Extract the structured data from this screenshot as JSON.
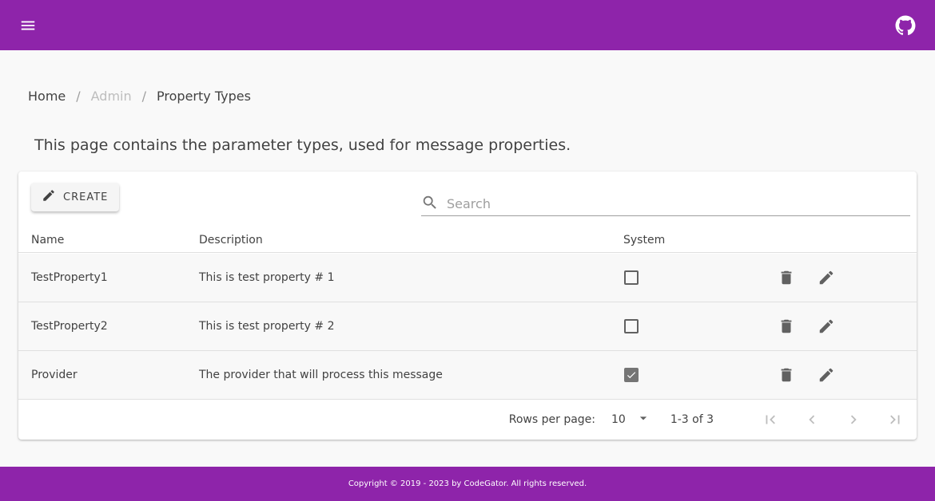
{
  "appbar": {
    "menu_icon": "menu-icon",
    "github_icon": "github-icon",
    "color": "#8e24aa"
  },
  "breadcrumb": {
    "items": [
      "Home",
      "Admin",
      "Property Types"
    ],
    "separator": "/"
  },
  "intro": "This page contains the parameter types, used for message properties.",
  "toolbar": {
    "create_label": "CREATE",
    "create_icon": "pencil-icon",
    "search_placeholder": "Search",
    "search_icon": "search-icon"
  },
  "table": {
    "columns": [
      "Name",
      "Description",
      "System"
    ],
    "rows": [
      {
        "name": "TestProperty1",
        "description": "This is test property # 1",
        "system": false
      },
      {
        "name": "TestProperty2",
        "description": "This is test property # 2",
        "system": false
      },
      {
        "name": "Provider",
        "description": "The provider that will process this message",
        "system": true
      }
    ],
    "row_actions": [
      "delete-icon",
      "edit-icon"
    ]
  },
  "pagination": {
    "rows_per_page_label": "Rows per page:",
    "rows_per_page_value": "10",
    "range": "1-3 of 3",
    "buttons": [
      "first-page-icon",
      "previous-page-icon",
      "next-page-icon",
      "last-page-icon"
    ]
  },
  "footer": {
    "text": "Copyright © 2019 - 2023 by CodeGator. All rights reserved."
  }
}
